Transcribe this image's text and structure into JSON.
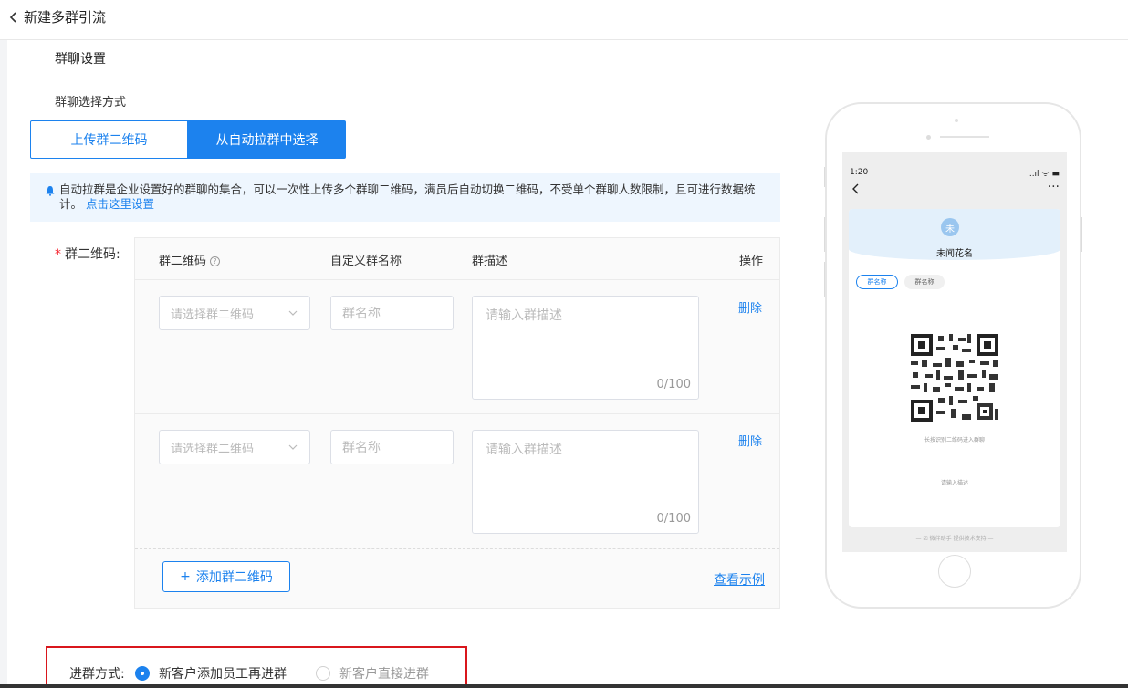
{
  "header": {
    "title": "新建多群引流"
  },
  "section": {
    "title": "群聊设置",
    "select_mode_label": "群聊选择方式"
  },
  "mode_tabs": [
    {
      "label": "上传群二维码",
      "active": false
    },
    {
      "label": "从自动拉群中选择",
      "active": true
    }
  ],
  "notice": {
    "text": "自动拉群是企业设置好的群聊的集合，可以一次性上传多个群聊二维码，满员后自动切换二维码，不受单个群聊人数限制，且可进行数据统计。",
    "link": "点击这里设置"
  },
  "qr_field": {
    "required_mark": "*",
    "label": "群二维码:"
  },
  "table": {
    "columns": [
      "群二维码",
      "自定义群名称",
      "群描述",
      "操作"
    ],
    "rows": [
      {
        "qr_placeholder": "请选择群二维码",
        "name_placeholder": "群名称",
        "desc_placeholder": "请输入群描述",
        "count": "0/100",
        "action": "删除"
      },
      {
        "qr_placeholder": "请选择群二维码",
        "name_placeholder": "群名称",
        "desc_placeholder": "请输入群描述",
        "count": "0/100",
        "action": "删除"
      }
    ],
    "add_button": "添加群二维码",
    "example_link": "查看示例"
  },
  "join": {
    "label": "进群方式:",
    "options": [
      {
        "label": "新客户添加员工再进群",
        "selected": true
      },
      {
        "label": "新客户直接进群",
        "selected": false
      }
    ]
  },
  "preview": {
    "time": "1:20",
    "signal": "..ıl ᯤ ▬",
    "more": "···",
    "avatar": "未",
    "name": "未闻花名",
    "chips": [
      "群名称",
      "群名称"
    ],
    "hint": "长按识别二维码进入群聊",
    "desc": "请输入描述",
    "footer": "— ☑ 微伴助手 提供技术支持 —"
  },
  "colors": {
    "primary": "#1c82ee",
    "highlight_border": "#d9161c",
    "required": "#f5222d"
  }
}
